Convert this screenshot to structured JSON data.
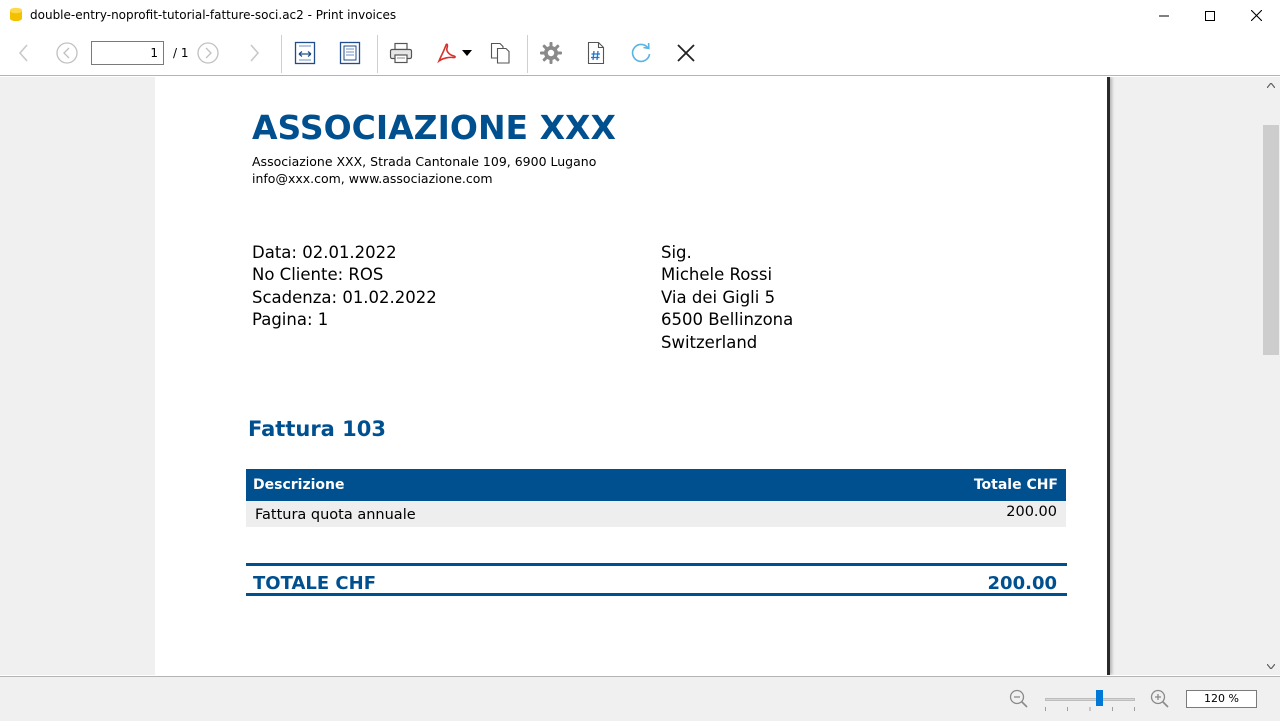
{
  "window": {
    "title": "double-entry-noprofit-tutorial-fatture-soci.ac2 - Print invoices",
    "controls": [
      "minimize-icon",
      "maximize-icon",
      "close-icon"
    ]
  },
  "toolbar": {
    "page_value": "1",
    "page_total": "/ 1",
    "icons": [
      "previous-page-icon",
      "first-page-icon",
      "last-page-icon",
      "next-page-icon",
      "fit-width-icon",
      "fit-page-icon",
      "print-icon",
      "pdf-icon",
      "dropdown-arrow-icon",
      "copy-icon",
      "settings-icon",
      "page-number-icon",
      "refresh-icon",
      "close-icon"
    ]
  },
  "invoice": {
    "org_name": "ASSOCIAZIONE XXX",
    "org_address": "Associazione XXX, Strada Cantonale 109, 6900 Lugano",
    "org_contact": "info@xxx.com, www.associazione.com",
    "info": {
      "date": "Data: 02.01.2022",
      "customer_no": "No Cliente: ROS",
      "due": "Scadenza: 01.02.2022",
      "page": "Pagina:  1"
    },
    "recipient": {
      "salutation": "Sig.",
      "name": "Michele Rossi",
      "street": "Via dei Gigli 5",
      "city": "6500 Bellinzona",
      "country": "Switzerland"
    },
    "title": "Fattura 103",
    "table": {
      "col_description": "Descrizione",
      "col_total": "Totale CHF",
      "rows": [
        {
          "description": "Fattura quota annuale",
          "amount": "200.00"
        }
      ]
    },
    "total_label": "TOTALE CHF",
    "total_value": "200.00"
  },
  "statusbar": {
    "zoom": "120 %",
    "zoom_level_fraction": 0.6,
    "icons": [
      "zoom-out-icon",
      "zoom-in-icon"
    ]
  },
  "colors": {
    "accent": "#004f8f",
    "row_background": "#eeeeee",
    "viewer_background": "#f0f0f0",
    "slider_thumb": "#0078d7"
  }
}
